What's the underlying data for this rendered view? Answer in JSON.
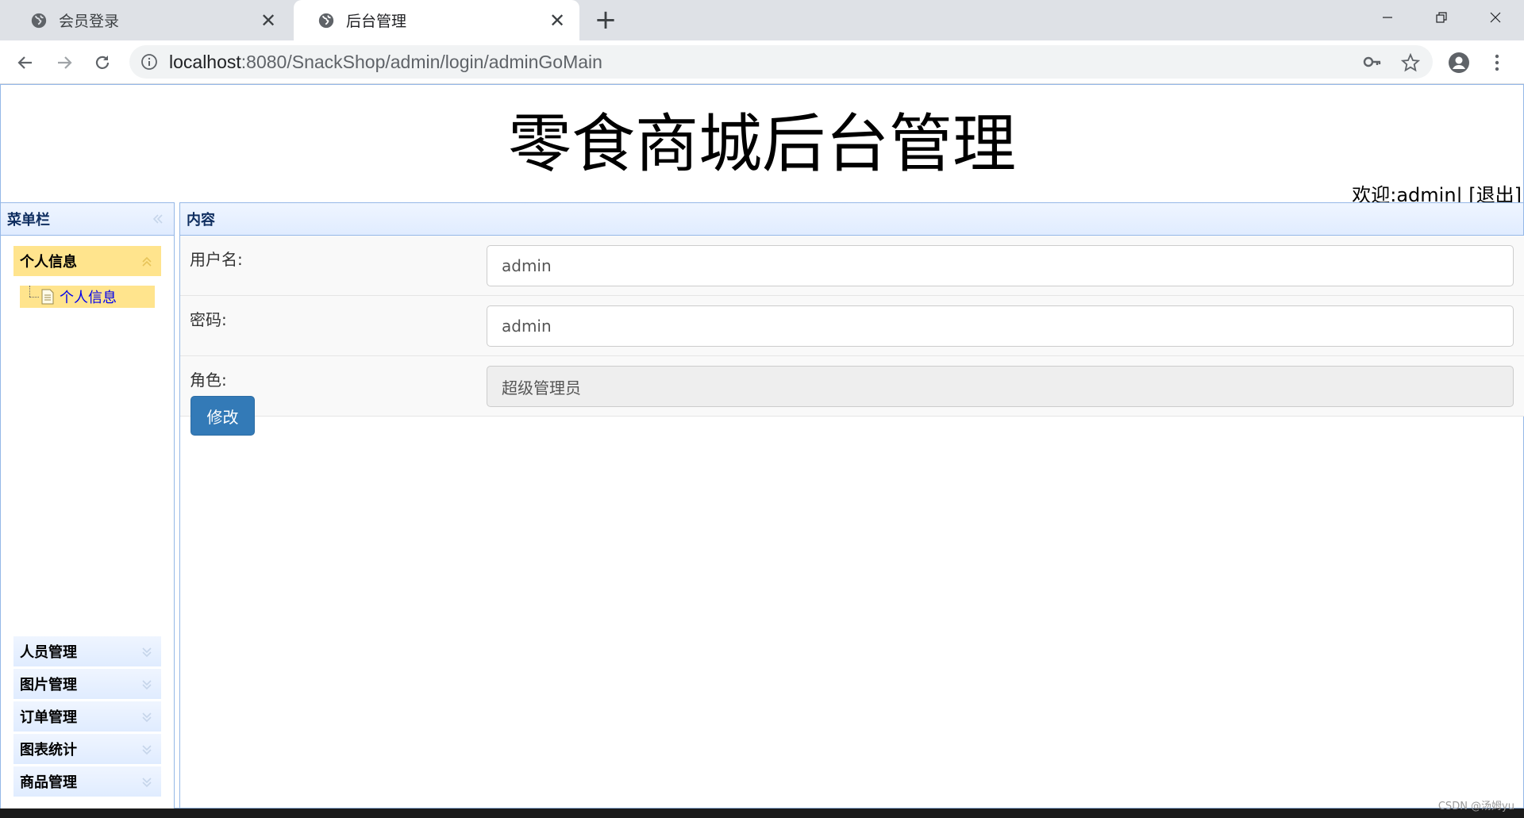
{
  "browser": {
    "tabs": [
      {
        "title": "会员登录",
        "active": false
      },
      {
        "title": "后台管理",
        "active": true
      }
    ],
    "url_host": "localhost",
    "url_path": ":8080/SnackShop/admin/login/adminGoMain",
    "icons": [
      "globe-icon",
      "close-icon",
      "plus-icon",
      "minimize-icon",
      "restore-icon",
      "window-close-icon",
      "back-arrow-icon",
      "forward-arrow-icon",
      "reload-icon",
      "info-icon",
      "key-icon",
      "star-icon",
      "account-icon",
      "more-vert-icon"
    ]
  },
  "header": {
    "title": "零食商城后台管理",
    "welcome_prefix": "欢迎:",
    "username": "admin",
    "separator": "|",
    "logout_link": "[退出]"
  },
  "sidebar": {
    "title": "菜单栏",
    "groups": [
      {
        "label": "个人信息",
        "open": true,
        "children": [
          "个人信息"
        ]
      },
      {
        "label": "人员管理",
        "open": false
      },
      {
        "label": "图片管理",
        "open": false
      },
      {
        "label": "订单管理",
        "open": false
      },
      {
        "label": "图表统计",
        "open": false
      },
      {
        "label": "商品管理",
        "open": false
      }
    ]
  },
  "content": {
    "title": "内容",
    "fields": [
      {
        "label": "用户名:",
        "value": "admin",
        "readonly": false
      },
      {
        "label": "密码:",
        "value": "admin",
        "readonly": false
      },
      {
        "label": "角色:",
        "value": "超级管理员",
        "readonly": true
      }
    ],
    "submit_label": "修改"
  },
  "watermark": "CSDN @汤姆yu",
  "colors": {
    "accent": "#337ab7",
    "panel_border": "#95b8e7",
    "selected": "#ffe48d",
    "tab_strip": "#dee1e6"
  }
}
